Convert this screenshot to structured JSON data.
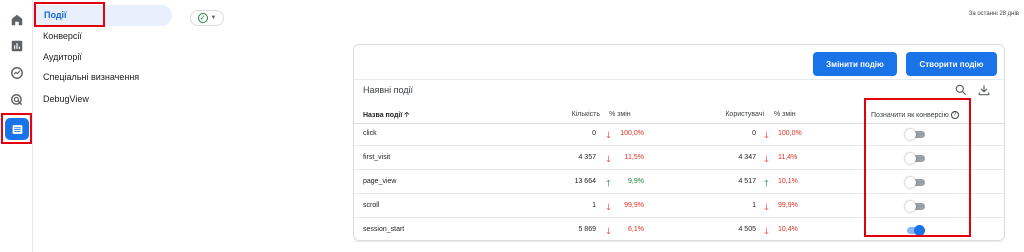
{
  "rail": {
    "icons": [
      "home-icon",
      "reports-bar-chart-icon",
      "explore-icon",
      "advertising-icon",
      "configure-events-icon"
    ]
  },
  "sidenav": {
    "items": [
      {
        "label": "Події"
      },
      {
        "label": "Конверсії"
      },
      {
        "label": "Аудиторії"
      },
      {
        "label": "Спеціальні визначення"
      },
      {
        "label": "DebugView"
      }
    ]
  },
  "header": {
    "date_range": "За останні 28 днів",
    "status_icon": "check-circle-icon"
  },
  "card": {
    "modify_button": "Змінити подію",
    "create_button": "Створити подію",
    "title": "Наявні події",
    "columns": {
      "name": "Назва події",
      "count": "Кількість",
      "count_change": "% змін",
      "users": "Користувачі",
      "users_change": "% змін",
      "mark_conversion": "Позначити як конверсію"
    },
    "rows": [
      {
        "name": "click",
        "count": "0",
        "count_dir": "down",
        "count_change": "100,0%",
        "users": "0",
        "users_dir": "down",
        "users_change": "100,0%",
        "conversion": false
      },
      {
        "name": "first_visit",
        "count": "4 357",
        "count_dir": "down",
        "count_change": "11,5%",
        "users": "4 347",
        "users_dir": "down",
        "users_change": "11,4%",
        "conversion": false
      },
      {
        "name": "page_view",
        "count": "13 664",
        "count_dir": "up",
        "count_change": "9,9%",
        "users": "4 517",
        "users_dir": "up",
        "users_change": "10,1%",
        "conversion": false
      },
      {
        "name": "scroll",
        "count": "1",
        "count_dir": "down",
        "count_change": "99,9%",
        "users": "1",
        "users_dir": "down",
        "users_change": "99,9%",
        "conversion": false
      },
      {
        "name": "session_start",
        "count": "5 869",
        "count_dir": "down",
        "count_change": "6,1%",
        "users": "4 505",
        "users_dir": "down",
        "users_change": "10,4%",
        "conversion": true
      }
    ]
  },
  "colors": {
    "accent": "#1a73e8",
    "highlight": "#e3000f",
    "negative": "#d93025",
    "positive": "#188038"
  }
}
